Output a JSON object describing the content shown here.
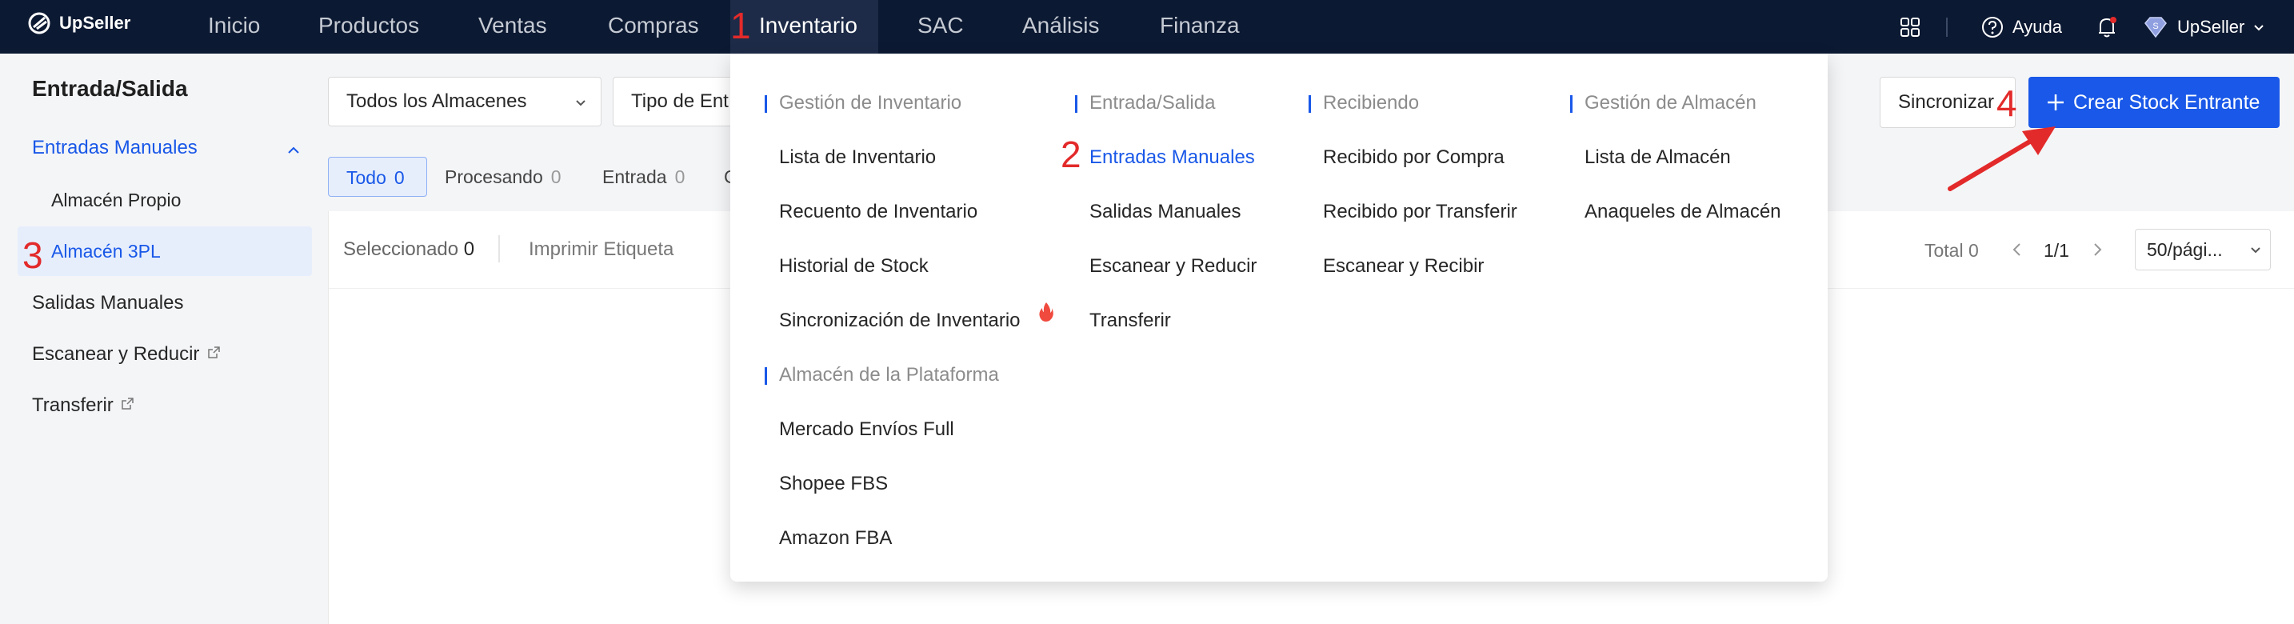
{
  "brand": "UpSeller",
  "nav": [
    "Inicio",
    "Productos",
    "Ventas",
    "Compras",
    "Inventario",
    "SAC",
    "Análisis",
    "Finanza"
  ],
  "topright": {
    "help": "Ayuda",
    "user": "UpSeller"
  },
  "sidebar": {
    "title": "Entrada/Salida",
    "items": {
      "manual_in": "Entradas Manuales",
      "own": "Almacén Propio",
      "tpl": "Almacén 3PL",
      "manual_out": "Salidas Manuales",
      "scan": "Escanear y Reducir",
      "transfer": "Transferir"
    }
  },
  "filters": {
    "warehouse": "Todos los Almacenes",
    "type": "Tipo de Ent"
  },
  "actions": {
    "sync": "Sincronizar",
    "create": "Crear Stock Entrante"
  },
  "tabs": [
    {
      "label": "Todo",
      "count": "0"
    },
    {
      "label": "Procesando",
      "count": "0"
    },
    {
      "label": "Entrada",
      "count": "0"
    },
    {
      "label": "C",
      "count": ""
    }
  ],
  "toolbar": {
    "selected_label": "Seleccionado",
    "selected_count": "0",
    "print": "Imprimir Etiqueta",
    "total": "Total 0",
    "page": "1/1",
    "page_size": "50/pági..."
  },
  "menu": {
    "inv": {
      "title": "Gestión de Inventario",
      "links": [
        "Lista de Inventario",
        "Recuento de Inventario",
        "Historial de Stock",
        "Sincronización de Inventario"
      ]
    },
    "plat": {
      "title": "Almacén de la Plataforma",
      "links": [
        "Mercado Envíos Full",
        "Shopee FBS",
        "Amazon FBA"
      ]
    },
    "io": {
      "title": "Entrada/Salida",
      "links": [
        "Entradas Manuales",
        "Salidas Manuales",
        "Escanear y Reducir",
        "Transferir"
      ]
    },
    "recv": {
      "title": "Recibiendo",
      "links": [
        "Recibido por Compra",
        "Recibido por Transferir",
        "Escanear y Recibir"
      ]
    },
    "wh": {
      "title": "Gestión de Almacén",
      "links": [
        "Lista de Almacén",
        "Anaqueles de Almacén"
      ]
    }
  },
  "annotations": [
    "1",
    "2",
    "3",
    "4"
  ],
  "colors": {
    "topbar": "#0c1932",
    "accent": "#1958e8",
    "annotation": "#e32a2a"
  }
}
